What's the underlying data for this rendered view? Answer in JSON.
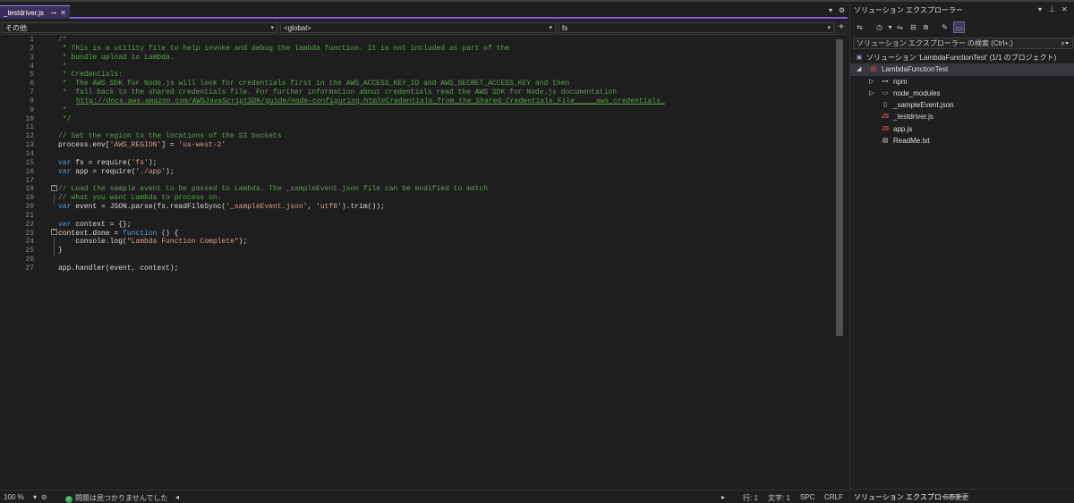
{
  "editor": {
    "tab": {
      "label": "_testdriver.js",
      "pin_icon": "pin-icon",
      "close_icon": "close-icon"
    },
    "tab_right": {
      "dropdown_icon": "chevron-down-icon",
      "settings_icon": "gear-icon"
    },
    "nav": {
      "project": "その他",
      "scope": "<global>",
      "member": "fs"
    },
    "lines": [
      "/*",
      " * This is a utility file to help invoke and debug the lambda function. It is not included as part of the",
      " * bundle upload to Lambda.",
      " *",
      " * Credentials:",
      " *  The AWS SDK for Node.js will look for credentials first in the AWS_ACCESS_KEY_ID and AWS_SECRET_ACCESS_KEY and then",
      " *  fall back to the shared credentials file. For further information about credentials read the AWS SDK for Node.js documentation",
      "http://docs.aws.amazon.com/AWSJavaScriptSDK/guide/node-configuring.html#Credentials_from_the_Shared_Credentials_File_____aws_credentials_",
      " *",
      " */",
      "",
      "// Set the region to the locations of the S3 buckets",
      "process.env['AWS_REGION'] = 'us-west-2'",
      "",
      "var fs = require('fs');",
      "var app = require('./app');",
      "",
      "// Load the sample event to be passed to Lambda. The _sampleEvent.json file can be modified to match",
      "// what you want Lambda to process on.",
      "var event = JSON.parse(fs.readFileSync('_sampleEvent.json', 'utf8').trim());",
      "",
      "var context = {};",
      "context.done = function () {",
      "    console.log(\"Lambda Function Complete\");",
      "}",
      "",
      "app.handler(event, context);"
    ],
    "line_numbers": [
      "1",
      "2",
      "3",
      "4",
      "5",
      "6",
      "7",
      "8",
      "9",
      "10",
      "11",
      "12",
      "13",
      "14",
      "15",
      "16",
      "17",
      "18",
      "19",
      "20",
      "21",
      "22",
      "23",
      "24",
      "25",
      "26",
      "27"
    ]
  },
  "status": {
    "zoom": "100 %",
    "issues": "問題は見つかりませんでした",
    "line": "行: 1",
    "char": "文字: 1",
    "spc": "SPC",
    "crlf": "CRLF"
  },
  "solution_explorer": {
    "title": "ソリューション エクスプローラー",
    "search_placeholder": "ソリューション エクスプローラー の検索 (Ctrl+;)",
    "items": [
      {
        "label": "ソリューション 'LambdaFunctionTest' (1/1 のプロジェクト)",
        "icon": "solution-icon"
      },
      {
        "label": "LambdaFunctionTest",
        "icon": "project-icon"
      },
      {
        "label": "npm",
        "icon": "npm-icon"
      },
      {
        "label": "node_modules",
        "icon": "folder-icon"
      },
      {
        "label": "_sampleEvent.json",
        "icon": "json-file-icon"
      },
      {
        "label": "_testdriver.js",
        "icon": "js-file-icon"
      },
      {
        "label": "app.js",
        "icon": "js-file-icon"
      },
      {
        "label": "ReadMe.txt",
        "icon": "text-file-icon"
      }
    ],
    "bottom_tabs": [
      "ソリューション エクスプローラー",
      "Git 変更"
    ]
  },
  "colors": {
    "accent": "#7b5cd6",
    "comment": "#57a64a",
    "keyword": "#569cd6",
    "string": "#d69d85"
  }
}
